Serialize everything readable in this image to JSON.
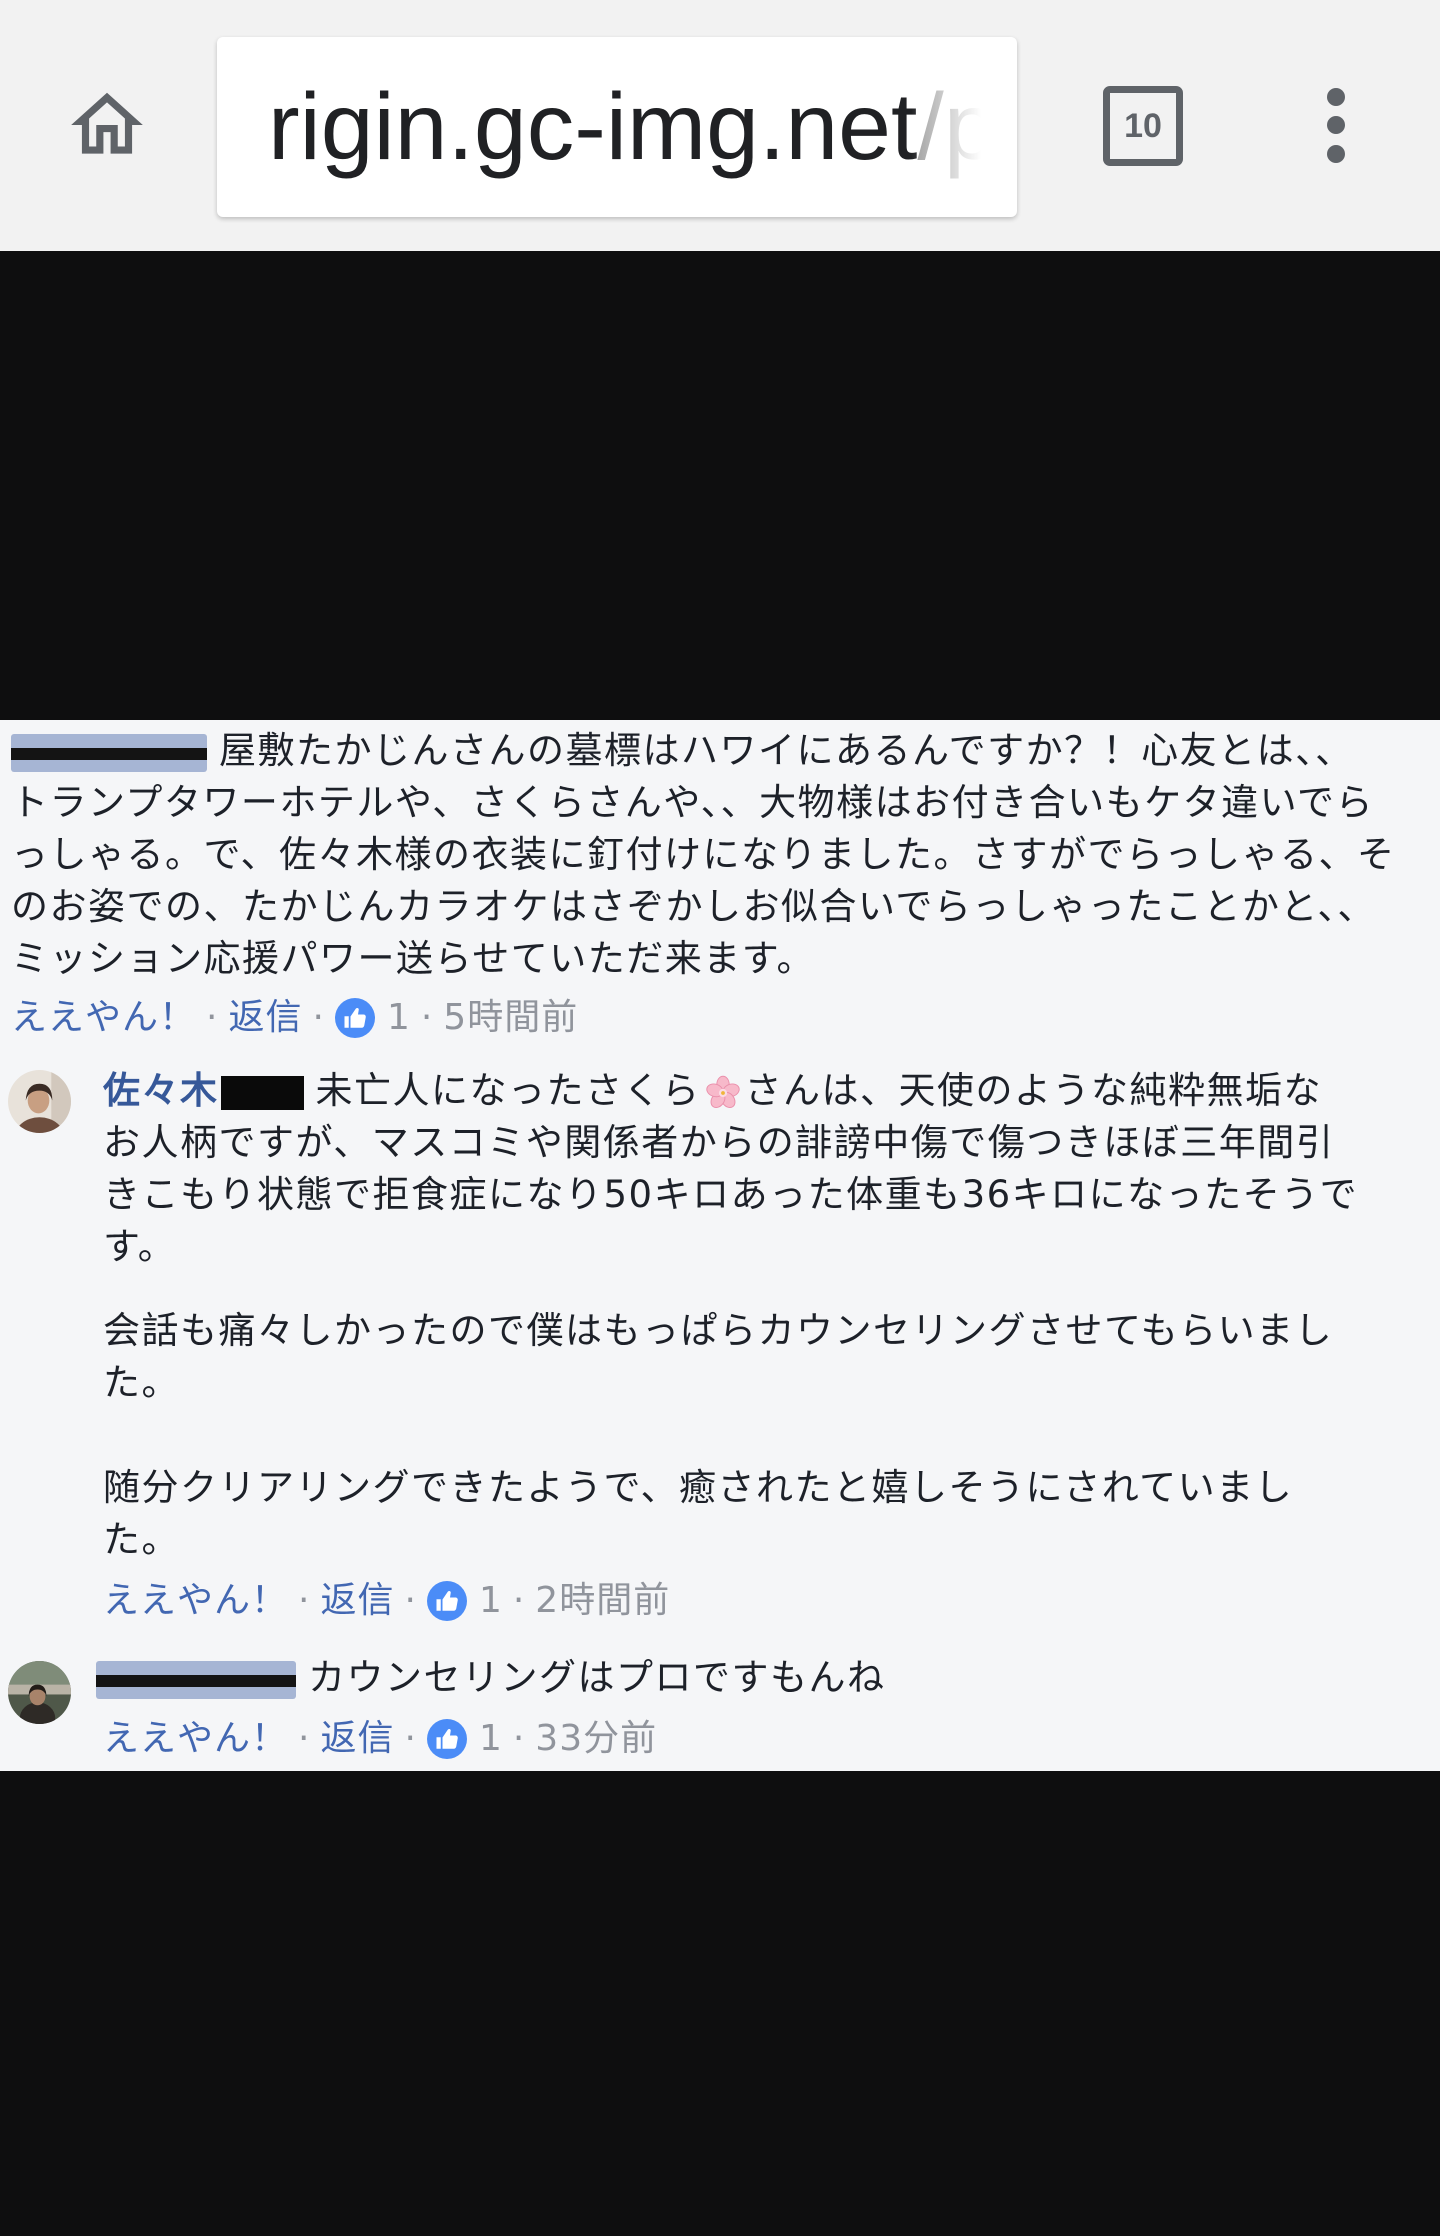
{
  "browser": {
    "url_host": "rigin.gc-img.net",
    "url_path": "/p",
    "tab_count": "10",
    "icons": {
      "home": "home-icon",
      "tab_switcher": "tab-switcher-icon",
      "menu": "overflow-menu-icon"
    }
  },
  "colors": {
    "toolbar_bg": "#f2f2f2",
    "backdrop": "#0e0e0f",
    "panel_bg": "#f5f6f8",
    "link_blue": "#4267b2",
    "author_blue": "#365899",
    "text": "#1d2129",
    "meta_grey": "#90949c",
    "reaction_blue": "#4b8cf7"
  },
  "separator": "·",
  "comments": [
    {
      "lines": [
        "屋敷たかじんさんの墓標はハワイにあるんですか？！心友とは、、",
        "トランプタワーホテルや、さくらさんや、、大物様はお付き合いもケタ違いでら",
        "っしゃる。で、佐々木様の衣装に釘付けになりました。さすがでらっしゃる、そ",
        "のお姿での、たかじんカラオケはさぞかしお似合いでらっしゃったことかと、、",
        "ミッション応援パワー送らせていただ来ます。"
      ],
      "actions": {
        "like_label": "ええやん！",
        "reply_label": "返信",
        "reaction_icon": "like-reaction-icon",
        "reaction_count": "1",
        "time": "5時間前"
      }
    },
    {
      "author": {
        "name_visible_part": "佐々木"
      },
      "first_line": {
        "before_icon": "未亡人になったさくら",
        "inline_icon": "cherry-blossom-icon",
        "after_icon": "さんは、天使のような純粋無垢な"
      },
      "paragraphs": [
        [
          "お人柄ですが、マスコミや関係者からの誹謗中傷で傷つきほぼ三年間引",
          "きこもり状態で拒食症になり50キロあった体重も36キロになったそうで",
          "す。"
        ],
        [
          "会話も痛々しかったので僕はもっぱらカウンセリングさせてもらいまし",
          "た。"
        ],
        [
          "随分クリアリングできたようで、癒されたと嬉しそうにされていまし",
          "た。"
        ]
      ],
      "actions": {
        "like_label": "ええやん！",
        "reply_label": "返信",
        "reaction_icon": "like-reaction-icon",
        "reaction_count": "1",
        "time": "2時間前"
      }
    },
    {
      "lines": [
        "カウンセリングはプロですもんね"
      ],
      "actions": {
        "like_label": "ええやん！",
        "reply_label": "返信",
        "reaction_icon": "like-reaction-icon",
        "reaction_count": "1",
        "time": "33分前"
      }
    }
  ]
}
